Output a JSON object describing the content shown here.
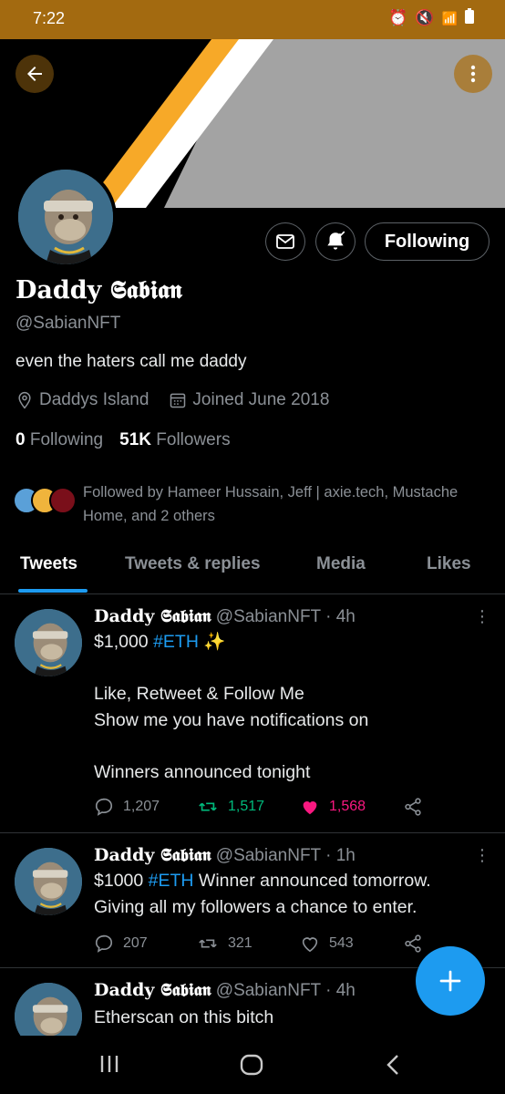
{
  "status_bar": {
    "time": "7:22"
  },
  "profile": {
    "name": "Daddy 𝕾𝖆𝖇𝖎𝖆𝖓",
    "handle": "@SabianNFT",
    "bio": "even the haters call me daddy",
    "location": "Daddys Island",
    "joined": "Joined June 2018",
    "following_count": "0",
    "following_label": "Following",
    "followers_count": "51K",
    "followers_label": "Followers",
    "followed_by_text": "Followed by Hameer Hussain, Jeff | axie.tech, Mustache Home, and 2 others",
    "follow_button_label": "Following"
  },
  "tabs": [
    {
      "label": "Tweets",
      "active": true
    },
    {
      "label": "Tweets & replies",
      "active": false
    },
    {
      "label": "Media",
      "active": false
    },
    {
      "label": "Likes",
      "active": false
    }
  ],
  "tweets": [
    {
      "name": "Daddy 𝕾𝖆𝖇𝖎𝖆𝖓",
      "handle": "@SabianNFT",
      "time": "· 4h",
      "line1_pre": "$1,000 ",
      "line1_tag": "#ETH",
      "line1_post": " ✨",
      "rest": "\nLike, Retweet & Follow Me\nShow me you have notifications on\n\nWinners announced tonight",
      "replies": "1,207",
      "retweets": "1,517",
      "likes": "1,568"
    },
    {
      "name": "Daddy 𝕾𝖆𝖇𝖎𝖆𝖓",
      "handle": "@SabianNFT",
      "time": "· 1h",
      "line1_pre": "$1000 ",
      "line1_tag": "#ETH",
      "line1_post": " Winner announced tomorrow.",
      "rest": "Giving all my followers a chance to enter.",
      "replies": "207",
      "retweets": "321",
      "likes": "543"
    },
    {
      "name": "Daddy 𝕾𝖆𝖇𝖎𝖆𝖓",
      "handle": "@SabianNFT",
      "time": "· 4h",
      "text": "Etherscan on this bitch"
    }
  ],
  "colors": {
    "accent": "#1d9bf0",
    "retweet": "#00ba7c",
    "like": "#f91880",
    "status_bar": "#a36a10"
  }
}
